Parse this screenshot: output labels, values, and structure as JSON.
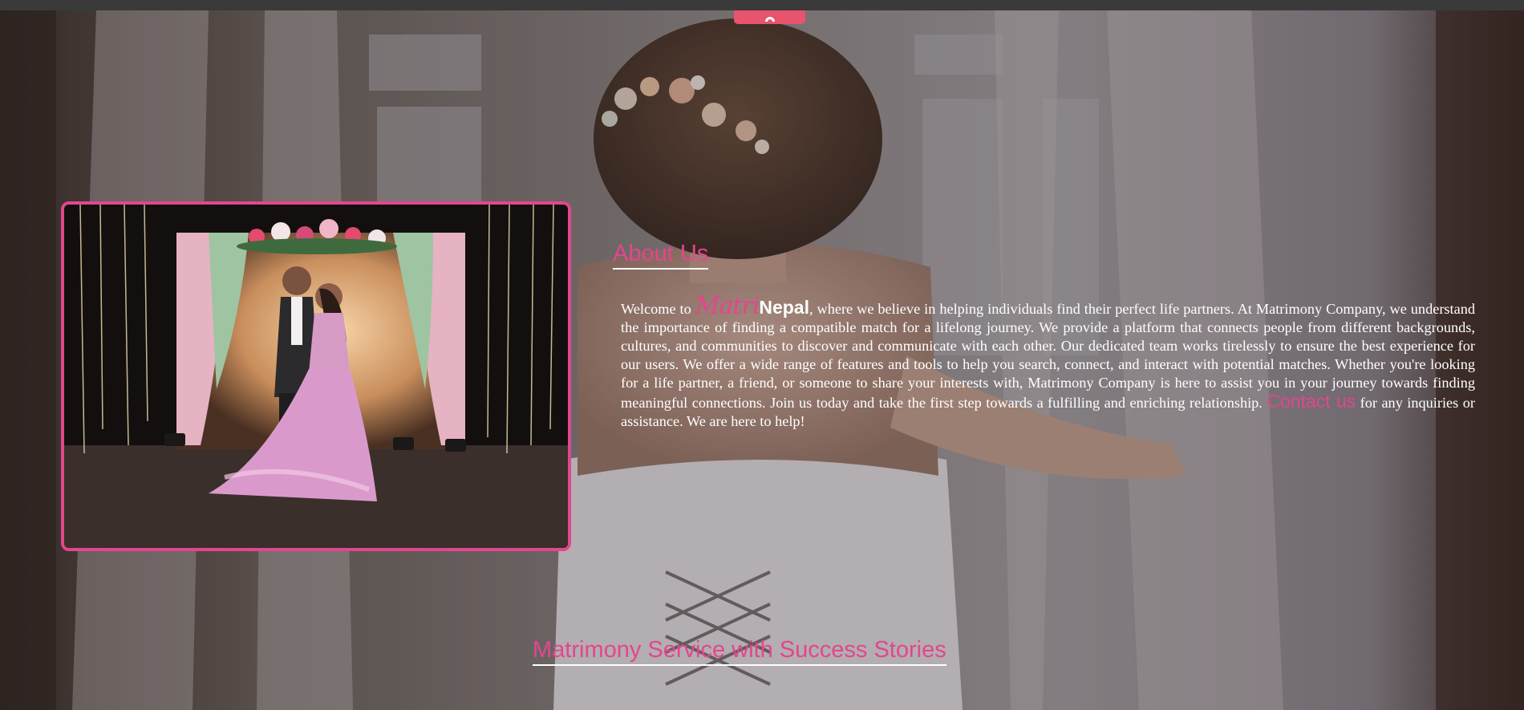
{
  "about": {
    "title": "About Us",
    "welcome": "Welcome to ",
    "brand_matri": "Matri",
    "brand_nepal": "Nepal",
    "body_text": ", where we believe in helping individuals find their perfect life partners. At Matrimony Company, we understand the importance of finding a compatible match for a lifelong journey. We provide a platform that connects people from different backgrounds, cultures, and communities to discover and communicate with each other. Our dedicated team works tirelessly to ensure the best experience for our users. We offer a wide range of features and tools to help you search, connect, and interact with potential matches. Whether you're looking for a life partner, a friend, or someone to share your interests with, Matrimony Company is here to assist you in your journey towards finding meaningful connections. Join us today and take the first step towards a fulfilling and enriching relationship. ",
    "contact_label": "Contact us",
    "closing_text": " for any inquiries or assistance. We are here to help!"
  },
  "stories": {
    "title": "Matrimony Service with Success Stories"
  },
  "icons": {
    "scroll_tab": "scroll-up-icon"
  },
  "colors": {
    "accent": "#e3468e",
    "tab": "#e8546c",
    "topbar": "#3a3a3a"
  }
}
